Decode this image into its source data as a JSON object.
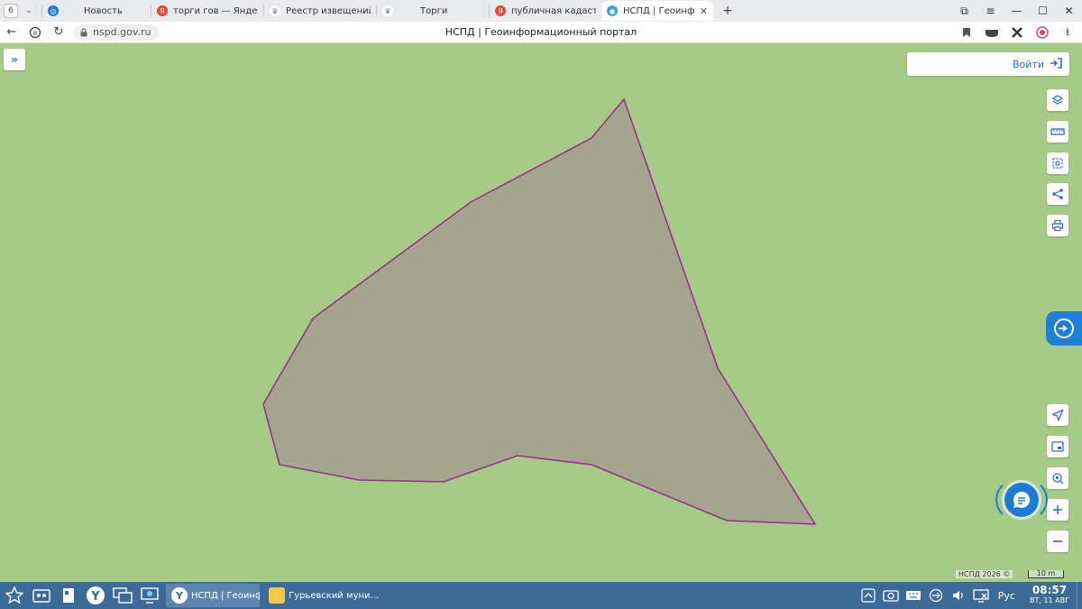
{
  "browser": {
    "tab_count": "6",
    "tabs": [
      {
        "label": "Новость",
        "favicon": "globe-icon",
        "color": "#1d7bd8",
        "active": false
      },
      {
        "label": "торги гов — Яндекс: наш",
        "favicon": "yandex-icon",
        "color": "#f2452e",
        "active": false
      },
      {
        "label": "Реестр извещений",
        "favicon": "emblem-icon",
        "color": "#5a7ab8",
        "active": false
      },
      {
        "label": "Торги",
        "favicon": "emblem-icon",
        "color": "#5a7ab8",
        "active": false
      },
      {
        "label": "публичная кадастровая",
        "favicon": "yandex-icon",
        "color": "#f2452e",
        "active": false
      },
      {
        "label": "НСПД | Геоинформац",
        "favicon": "nspd-icon",
        "color": "#37a6c9",
        "active": true
      }
    ],
    "url": "nspd.gov.ru",
    "page_title": "НСПД | Геоинформационный портал"
  },
  "map": {
    "login_label": "Войти",
    "copyright": "НСПД 2026 ©",
    "scale_label": "10 m",
    "colors": {
      "background": "#a6cb86",
      "parcel_fill": "#a3a58c",
      "parcel_stroke": "#9a2a8e",
      "accent": "#2b6fcb"
    },
    "tools_top": [
      "layers-icon",
      "ruler-icon",
      "select-area-icon",
      "share-icon",
      "print-icon"
    ],
    "tools_bottom": [
      "geolocate-icon",
      "minimap-icon",
      "pin-search-icon",
      "zoom-in-icon",
      "zoom-out-icon"
    ]
  },
  "taskbar": {
    "tasks": [
      {
        "label": "НСПД | Геоинфор...",
        "active": true
      },
      {
        "label": "Гурьевский муни...",
        "active": false
      }
    ],
    "language": "Рус",
    "time": "08:57",
    "date": "ВТ, 11 АВГ"
  }
}
